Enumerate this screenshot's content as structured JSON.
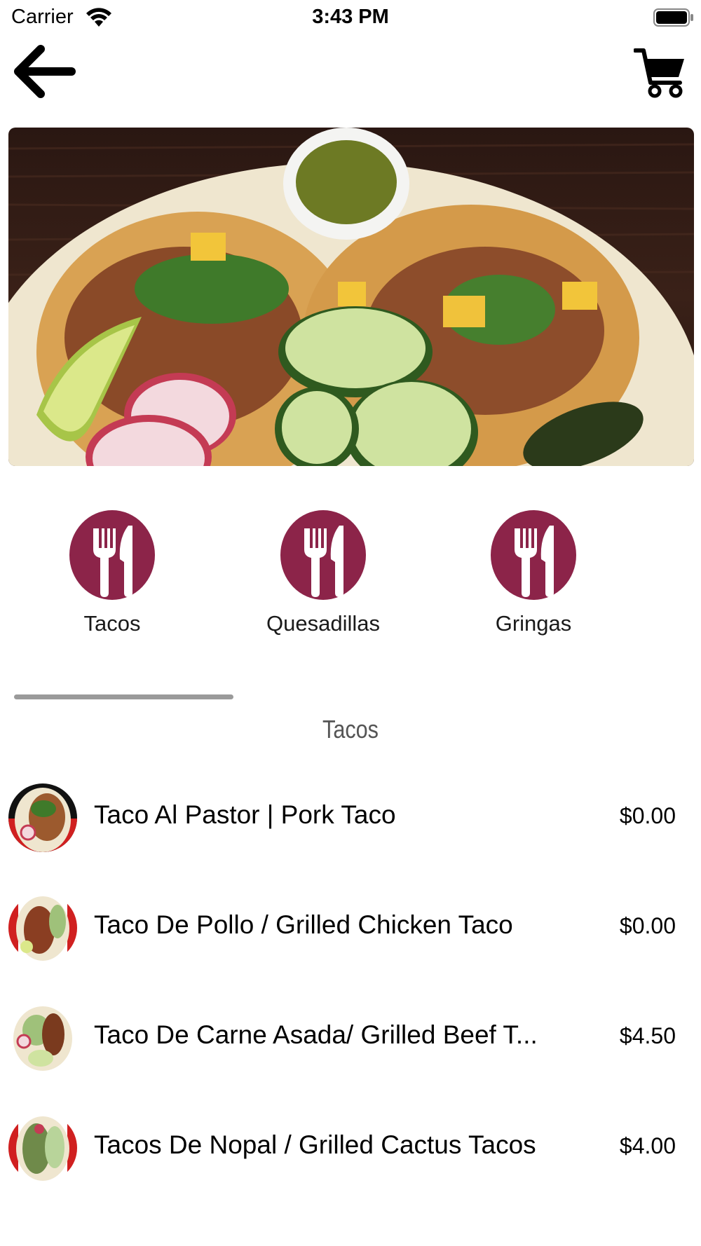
{
  "status_bar": {
    "carrier": "Carrier",
    "time": "3:43 PM"
  },
  "nav": {
    "back_icon": "arrow-left-icon",
    "cart_icon": "shopping-cart-icon"
  },
  "hero": {
    "image": "tacos-plate-photo"
  },
  "categories": [
    {
      "label": "Tacos",
      "icon": "fork-knife-icon"
    },
    {
      "label": "Quesadillas",
      "icon": "fork-knife-icon"
    },
    {
      "label": "Gringas",
      "icon": "fork-knife-icon"
    }
  ],
  "section": {
    "title": "Tacos"
  },
  "items": [
    {
      "name": "Taco Al Pastor | Pork Taco",
      "price": "$0.00"
    },
    {
      "name": "Taco De Pollo / Grilled Chicken Taco",
      "price": "$0.00"
    },
    {
      "name": "Taco De Carne Asada/ Grilled Beef T...",
      "price": "$4.50"
    },
    {
      "name": "Tacos De Nopal / Grilled Cactus Tacos",
      "price": "$4.00"
    }
  ],
  "colors": {
    "accent": "#8c2449",
    "divider": "#9a9a9a"
  }
}
